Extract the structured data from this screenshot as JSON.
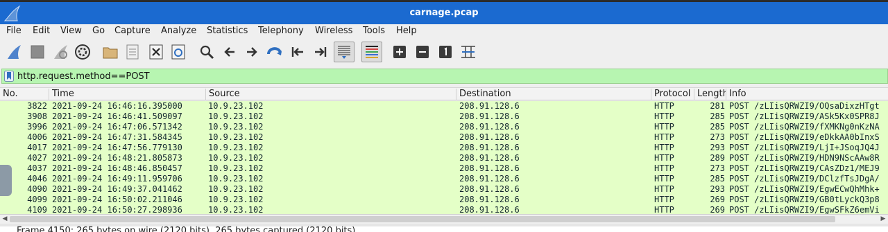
{
  "window": {
    "title": "carnage.pcap"
  },
  "menu": [
    "File",
    "Edit",
    "View",
    "Go",
    "Capture",
    "Analyze",
    "Statistics",
    "Telephony",
    "Wireless",
    "Tools",
    "Help"
  ],
  "toolbar": {
    "buttons": [
      "shark-fin-start-icon",
      "stop-capture-icon",
      "restart-capture-icon",
      "capture-options-gear-icon",
      "open-folder-icon",
      "file-set-icon",
      "close-file-icon",
      "reload-icon",
      "find-packet-icon",
      "back-icon",
      "forward-icon",
      "go-to-packet-icon",
      "first-packet-icon",
      "last-packet-icon",
      "autoscroll-icon",
      "colorize-icon",
      "zoom-in-icon",
      "zoom-out-icon",
      "normal-size-icon",
      "resize-columns-icon"
    ]
  },
  "filter": {
    "value": "http.request.method==POST"
  },
  "columns": [
    "No.",
    "Time",
    "Source",
    "Destination",
    "Protocol",
    "Length",
    "Info"
  ],
  "packets": [
    {
      "no": "3822",
      "time": "2021-09-24 16:46:16.395000",
      "src": "10.9.23.102",
      "dst": "208.91.128.6",
      "proto": "HTTP",
      "len": "281",
      "info": "POST /zLIisQRWZI9/OQsaDixzHTgt"
    },
    {
      "no": "3908",
      "time": "2021-09-24 16:46:41.509097",
      "src": "10.9.23.102",
      "dst": "208.91.128.6",
      "proto": "HTTP",
      "len": "285",
      "info": "POST /zLIisQRWZI9/ASk5Kx0SPR8J"
    },
    {
      "no": "3996",
      "time": "2021-09-24 16:47:06.571342",
      "src": "10.9.23.102",
      "dst": "208.91.128.6",
      "proto": "HTTP",
      "len": "285",
      "info": "POST /zLIisQRWZI9/fXMKNg0nKzNA"
    },
    {
      "no": "4006",
      "time": "2021-09-24 16:47:31.584345",
      "src": "10.9.23.102",
      "dst": "208.91.128.6",
      "proto": "HTTP",
      "len": "273",
      "info": "POST /zLIisQRWZI9/eDkkAA0bInxS"
    },
    {
      "no": "4017",
      "time": "2021-09-24 16:47:56.779130",
      "src": "10.9.23.102",
      "dst": "208.91.128.6",
      "proto": "HTTP",
      "len": "293",
      "info": "POST /zLIisQRWZI9/LjI+JSoqJQ4J"
    },
    {
      "no": "4027",
      "time": "2021-09-24 16:48:21.805873",
      "src": "10.9.23.102",
      "dst": "208.91.128.6",
      "proto": "HTTP",
      "len": "289",
      "info": "POST /zLIisQRWZI9/HDN9NScAAw8R"
    },
    {
      "no": "4037",
      "time": "2021-09-24 16:48:46.850457",
      "src": "10.9.23.102",
      "dst": "208.91.128.6",
      "proto": "HTTP",
      "len": "273",
      "info": "POST /zLIisQRWZI9/CAsZDz1/MEJ9"
    },
    {
      "no": "4046",
      "time": "2021-09-24 16:49:11.959706",
      "src": "10.9.23.102",
      "dst": "208.91.128.6",
      "proto": "HTTP",
      "len": "285",
      "info": "POST /zLIisQRWZI9/DClzfTsJDgA/"
    },
    {
      "no": "4090",
      "time": "2021-09-24 16:49:37.041462",
      "src": "10.9.23.102",
      "dst": "208.91.128.6",
      "proto": "HTTP",
      "len": "293",
      "info": "POST /zLIisQRWZI9/EgwECwQhMhk+"
    },
    {
      "no": "4099",
      "time": "2021-09-24 16:50:02.211046",
      "src": "10.9.23.102",
      "dst": "208.91.128.6",
      "proto": "HTTP",
      "len": "269",
      "info": "POST /zLIisQRWZI9/GB0tLyckQ3p8"
    },
    {
      "no": "4109",
      "time": "2021-09-24 16:50:27.298936",
      "src": "10.9.23.102",
      "dst": "208.91.128.6",
      "proto": "HTTP",
      "len": "269",
      "info": "POST /zLIisQRWZI9/EgwSFkZ6emVi"
    }
  ],
  "detail": {
    "line": "Frame 4150: 265 bytes on wire (2120 bits), 265 bytes captured (2120 bits)"
  },
  "colors": {
    "titlebar": "#1b6ad0",
    "filter_ok": "#b7f5b1",
    "http_row": "#e4ffc7"
  }
}
